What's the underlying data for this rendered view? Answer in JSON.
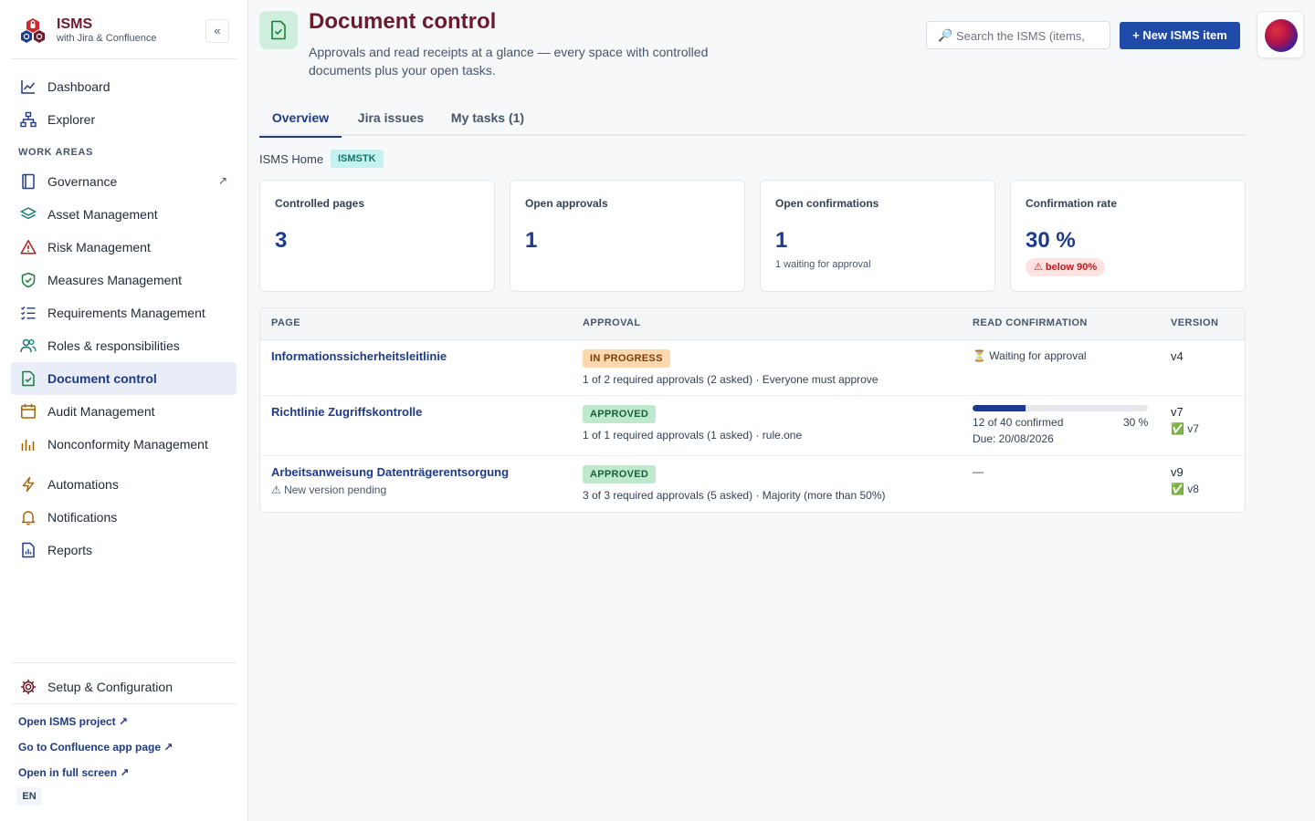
{
  "brand": {
    "title": "ISMS",
    "subtitle": "with Jira & Confluence",
    "collapse": "«"
  },
  "nav": {
    "dashboard": "Dashboard",
    "explorer": "Explorer",
    "section": "WORK AREAS",
    "governance": "Governance",
    "governance_ext": "↗",
    "asset": "Asset Management",
    "risk": "Risk Management",
    "measures": "Measures Management",
    "requirements": "Requirements Management",
    "roles": "Roles & responsibilities",
    "document": "Document control",
    "audit": "Audit Management",
    "nonconformity": "Nonconformity Management",
    "automations": "Automations",
    "notifications": "Notifications",
    "reports": "Reports",
    "setup": "Setup & Configuration"
  },
  "footer": {
    "open_project": "Open ISMS project ↗",
    "confluence": "Go to Confluence app page ↗",
    "fullscreen": "Open in full screen ↗",
    "lang": "EN"
  },
  "header": {
    "title": "Document control",
    "description": "Approvals and read receipts at a glance — every space with controlled documents plus your open tasks.",
    "search_placeholder": "Search the ISMS (items,",
    "search_icon": "🔎",
    "new_button": "+ New ISMS item"
  },
  "tabs": [
    "Overview",
    "Jira issues",
    "My tasks (1)"
  ],
  "space": {
    "label": "ISMS Home",
    "key": "ISMSTK"
  },
  "cards": [
    {
      "label": "Controlled pages",
      "value": "3"
    },
    {
      "label": "Open approvals",
      "value": "1"
    },
    {
      "label": "Open confirmations",
      "value": "1",
      "note": "1 waiting for approval"
    },
    {
      "label": "Confirmation rate",
      "value": "30 %",
      "badge": "⚠ below 90%"
    }
  ],
  "table": {
    "headers": [
      "PAGE",
      "APPROVAL",
      "READ CONFIRMATION",
      "VERSION"
    ],
    "rows": [
      {
        "page": "Informationssicherheitsleitlinie",
        "status": "IN PROGRESS",
        "approval": "1 of 2 required approvals (2 asked) · Everyone must approve",
        "read": "⏳ Waiting for approval",
        "version": "v4"
      },
      {
        "page": "Richtlinie Zugriffskontrolle",
        "status": "APPROVED",
        "approval": "1 of 1 required approvals (1 asked) · rule.one",
        "read_confirmed": "12 of 40 confirmed",
        "read_percent": "30 %",
        "read_fraction": 0.3,
        "read_due": "Due: 20/08/2026",
        "version": "v7",
        "version_approved": "✅ v7"
      },
      {
        "page": "Arbeitsanweisung Datenträgerentsorgung",
        "page_note": "⚠ New version pending",
        "status": "APPROVED",
        "approval": "3 of 3 required approvals (5 asked) · Majority (more than 50%)",
        "read": "—",
        "version": "v9",
        "version_approved": "✅ v8"
      }
    ]
  },
  "colors": {
    "accent": "#1e3a8a",
    "brand_title": "#6b1b2c",
    "button": "#1f4aa8"
  }
}
